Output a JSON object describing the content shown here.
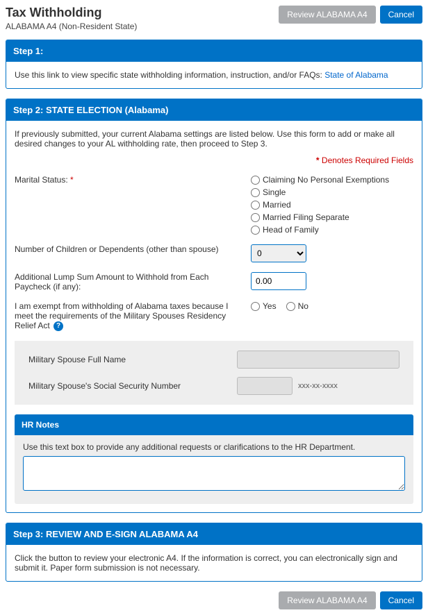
{
  "header": {
    "title": "Tax Withholding",
    "subtitle": "ALABAMA A4 (Non-Resident State)",
    "review_btn": "Review ALABAMA A4",
    "cancel_btn": "Cancel"
  },
  "step1": {
    "title": "Step 1:",
    "text": "Use this link to view specific state withholding information, instruction, and/or FAQs: ",
    "link_text": "State of Alabama"
  },
  "step2": {
    "title": "Step 2: STATE ELECTION (Alabama)",
    "intro": "If previously submitted, your current Alabama settings are listed below. Use this form to add or make all desired changes to your AL withholding rate, then proceed to Step 3.",
    "required_note": "Denotes Required Fields",
    "marital": {
      "label": "Marital Status:",
      "options": {
        "o1": "Claiming No Personal Exemptions",
        "o2": "Single",
        "o3": "Married",
        "o4": "Married Filing Separate",
        "o5": "Head of Family"
      }
    },
    "dependents_label": "Number of Children or Dependents (other than spouse)",
    "dependents_value": "0",
    "lumpsum_label": "Additional Lump Sum Amount to Withhold from Each Paycheck (if any):",
    "lumpsum_value": "0.00",
    "exempt_label": "I am exempt from withholding of Alabama taxes because I meet the requirements of the Military Spouses Residency Relief Act",
    "yes": "Yes",
    "no": "No",
    "spouse_name_label": "Military Spouse Full Name",
    "spouse_ssn_label": "Military Spouse's Social Security Number",
    "ssn_mask": "xxx-xx-xxxx",
    "hr_title": "HR Notes",
    "hr_text": "Use this text box to provide any additional requests or clarifications to the HR Department."
  },
  "step3": {
    "title": "Step 3: REVIEW AND E-SIGN ALABAMA A4",
    "text": "Click the button to review your electronic A4. If the information is correct, you can electronically sign and submit it. Paper form submission is not necessary."
  },
  "footer": {
    "review_btn": "Review ALABAMA A4",
    "cancel_btn": "Cancel"
  }
}
